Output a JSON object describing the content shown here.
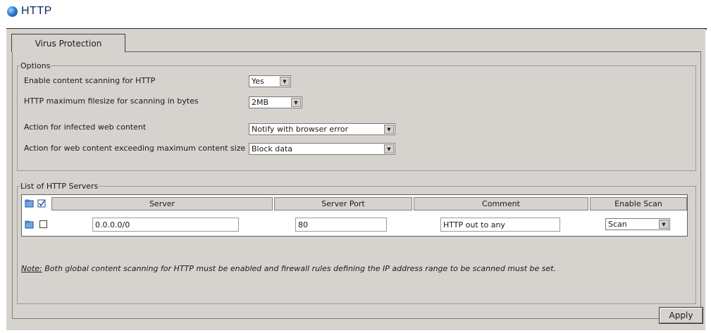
{
  "header": {
    "title": "HTTP",
    "icon": "globe-icon"
  },
  "tabs": [
    {
      "label": "Virus Protection",
      "active": true
    }
  ],
  "options": {
    "legend": "Options",
    "rows": [
      {
        "label": "Enable content scanning for HTTP",
        "value": "Yes"
      },
      {
        "label": "HTTP maximum filesize for scanning in bytes",
        "value": "2MB"
      },
      {
        "label": "Action for infected web content",
        "value": "Notify with browser error"
      },
      {
        "label": "Action for web content exceeding maximum content size",
        "value": "Block data"
      }
    ]
  },
  "servers": {
    "legend": "List of HTTP Servers",
    "columns": [
      "Server",
      "Server Port",
      "Comment",
      "Enable Scan"
    ],
    "rows": [
      {
        "server": "0.0.0.0/0",
        "port": "80",
        "comment": "HTTP out to any",
        "enable_scan": "Scan"
      }
    ]
  },
  "note": {
    "lead": "Note:",
    "text": " Both global content scanning for HTTP must be enabled and firewall rules defining the IP address range to be scanned must be set."
  },
  "apply_label": "Apply",
  "colors": {
    "panel": "#d6d3ce",
    "title": "#0c2a66"
  }
}
